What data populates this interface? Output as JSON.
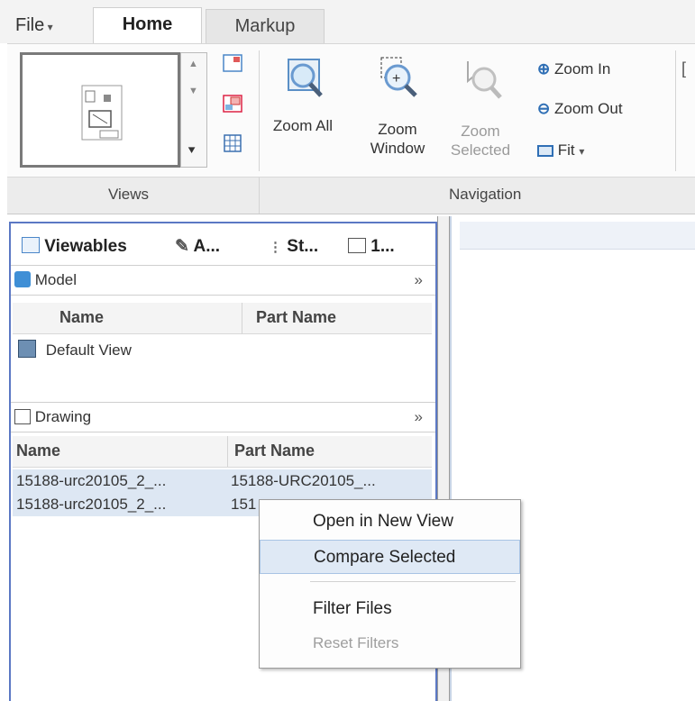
{
  "ribbon": {
    "tabs": {
      "file": "File",
      "home": "Home",
      "markup": "Markup"
    },
    "groups": {
      "views": "Views",
      "navigation": "Navigation"
    },
    "buttons": {
      "zoom_all": "Zoom All",
      "zoom_window_1": "Zoom",
      "zoom_window_2": "Window",
      "zoom_selected_1": "Zoom",
      "zoom_selected_2": "Selected",
      "zoom_in": "Zoom In",
      "zoom_out": "Zoom Out",
      "fit": "Fit"
    }
  },
  "panel": {
    "tabs": {
      "viewables": "Viewables",
      "annotations": "A...",
      "structure": "St...",
      "sheets": "1..."
    },
    "model": {
      "title": "Model",
      "columns": {
        "name": "Name",
        "part_name": "Part Name"
      },
      "rows": [
        {
          "name": "Default View"
        }
      ]
    },
    "drawing": {
      "title": "Drawing",
      "columns": {
        "name": "Name",
        "part_name": "Part Name"
      },
      "rows": [
        {
          "name": "15188-urc20105_2_...",
          "part_name": "15188-URC20105_..."
        },
        {
          "name": "15188-urc20105_2_...",
          "part_name": "151"
        }
      ]
    }
  },
  "context_menu": {
    "items": [
      {
        "label": "Open in New View",
        "enabled": true
      },
      {
        "label": "Compare Selected",
        "enabled": true,
        "highlighted": true
      },
      {
        "label": "Filter Files",
        "enabled": true
      },
      {
        "label": "Reset Filters",
        "enabled": false
      }
    ]
  },
  "colors": {
    "panel_border": "#5b78c4",
    "selection": "#dde7f3",
    "menu_highlight": "#dfe9f5"
  },
  "icons": [
    "model-cube-icon",
    "camera-view-icon",
    "drawing-sheet-icon",
    "zoom-all-icon",
    "zoom-window-icon",
    "zoom-selected-icon",
    "zoom-in-icon",
    "zoom-out-icon",
    "fit-icon",
    "expand-chevron-icon"
  ]
}
